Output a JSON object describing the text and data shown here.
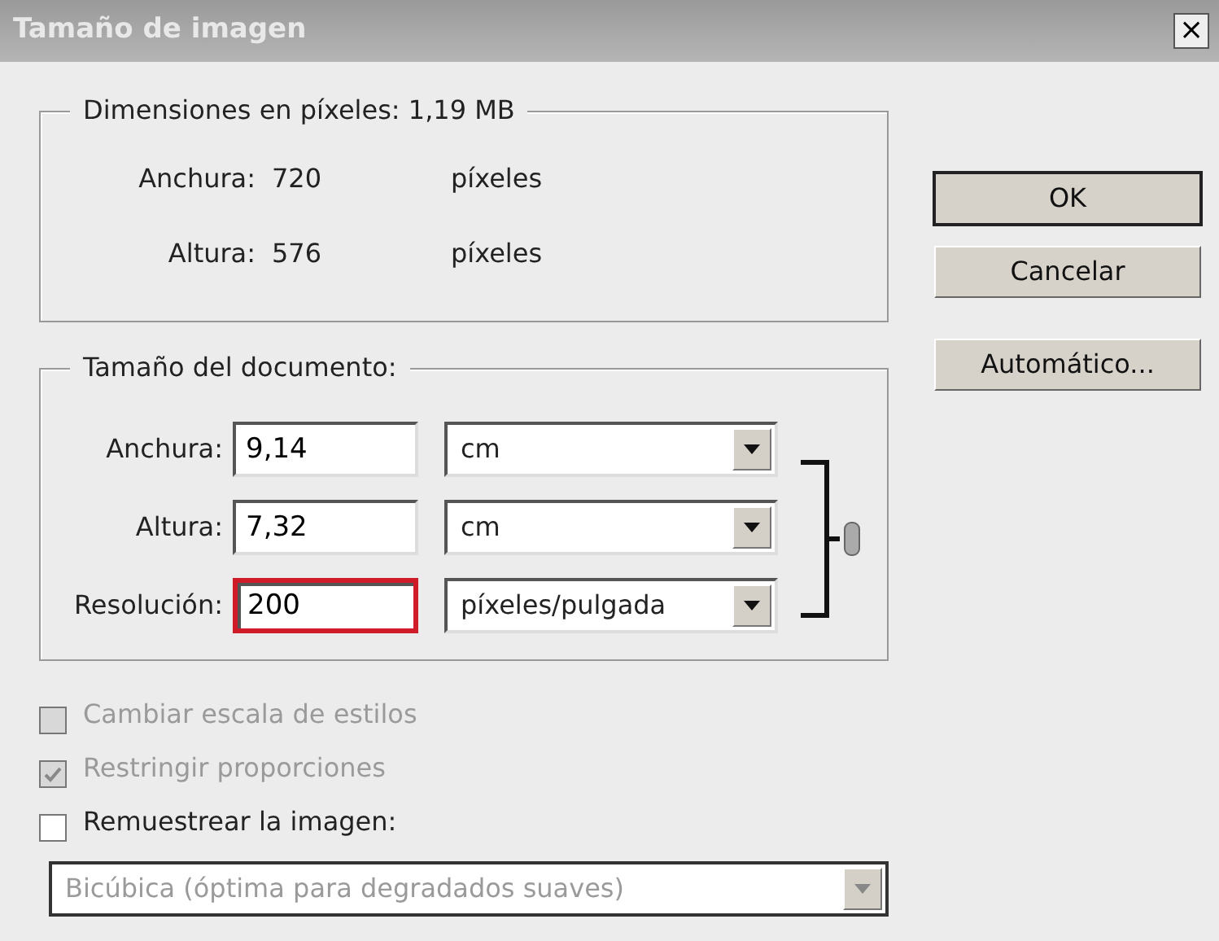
{
  "window": {
    "title": "Tamaño de imagen",
    "close": "×"
  },
  "pixel_dimensions": {
    "legend": "Dimensiones en píxeles: 1,19 MB",
    "rows": [
      {
        "label": "Anchura:",
        "value": "720",
        "unit": "píxeles"
      },
      {
        "label": "Altura:",
        "value": "576",
        "unit": "píxeles"
      }
    ]
  },
  "document_size": {
    "legend": "Tamaño del documento:",
    "rows": [
      {
        "label": "Anchura:",
        "value": "9,14",
        "unit": "cm",
        "highlighted": false
      },
      {
        "label": "Altura:",
        "value": "7,32",
        "unit": "cm",
        "highlighted": false
      },
      {
        "label": "Resolución:",
        "value": "200",
        "unit": "píxeles/pulgada",
        "highlighted": true
      }
    ]
  },
  "options": [
    {
      "label": "Cambiar escala de estilos",
      "checked": false,
      "disabled": true
    },
    {
      "label": "Restringir proporciones",
      "checked": true,
      "disabled": true
    },
    {
      "label": "Remuestrear la imagen:",
      "checked": false,
      "disabled": false
    }
  ],
  "resample_method": {
    "value": "Bicúbica (óptima para degradados suaves)",
    "disabled": true
  },
  "buttons": [
    {
      "label": "OK",
      "default": true
    },
    {
      "label": "Cancelar",
      "default": false
    },
    {
      "label": "Automático...",
      "default": false
    }
  ]
}
